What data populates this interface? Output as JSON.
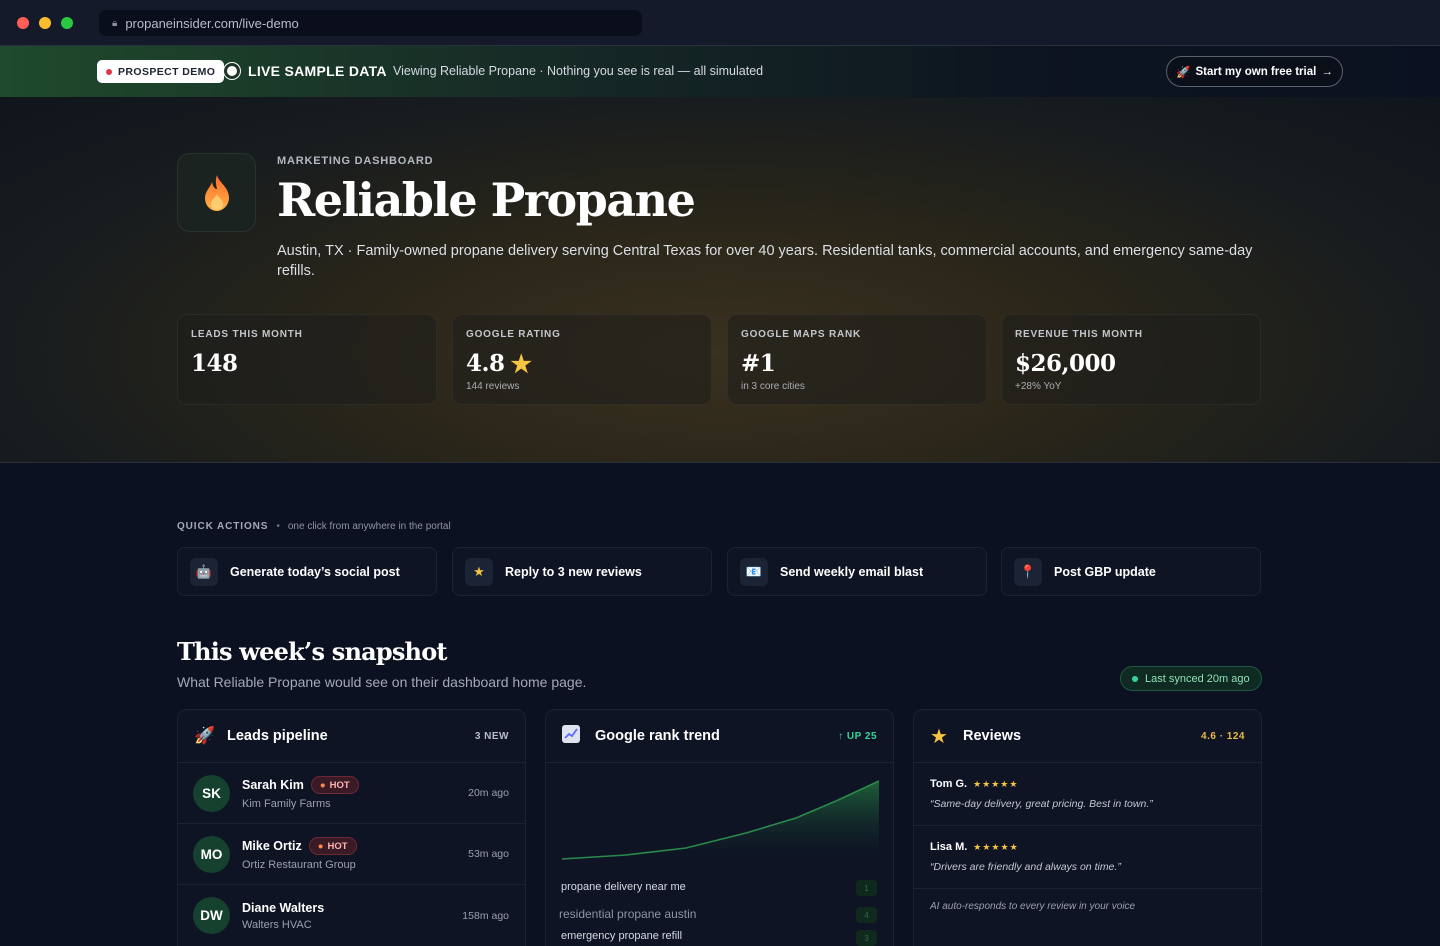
{
  "browser": {
    "url": "propaneinsider.com/live-demo"
  },
  "banner": {
    "demo_pill": "PROSPECT DEMO",
    "live_label": "LIVE SAMPLE DATA",
    "note": "Viewing Reliable Propane · Nothing you see is real — all simulated",
    "trial_button": "Start my own free trial",
    "trial_arrow": "→"
  },
  "hero": {
    "eyebrow": "MARKETING DASHBOARD",
    "title": "Reliable Propane",
    "description": "Austin, TX · Family-owned propane delivery serving Central Texas for over 40 years. Residential tanks, commercial accounts, and emergency same-day refills."
  },
  "stats": [
    {
      "label": "LEADS THIS MONTH",
      "value": "148",
      "sub": ""
    },
    {
      "label": "GOOGLE RATING",
      "value": "4.8",
      "sub": "144 reviews"
    },
    {
      "label": "GOOGLE MAPS RANK",
      "value": "#1",
      "sub": "in 3 core cities"
    },
    {
      "label": "REVENUE THIS MONTH",
      "value": "$26,000",
      "sub": "+28% YoY"
    }
  ],
  "quick_actions": {
    "title": "QUICK ACTIONS",
    "note": "one click from anywhere in the portal",
    "items": [
      {
        "label": "Generate today’s social post",
        "icon": "robot-icon"
      },
      {
        "label": "Reply to 3 new reviews",
        "icon": "star-icon"
      },
      {
        "label": "Send weekly email blast",
        "icon": "email-icon"
      },
      {
        "label": "Post GBP update",
        "icon": "pin-icon"
      }
    ]
  },
  "snapshot": {
    "title": "This week’s snapshot",
    "subtitle": "What Reliable Propane would see on their dashboard home page.",
    "sync": "Last synced 20m ago"
  },
  "leads_card": {
    "title": "Leads pipeline",
    "badge": "3 NEW",
    "hot_label": "HOT",
    "leads": [
      {
        "initials": "SK",
        "name": "Sarah Kim",
        "company": "Kim Family Farms",
        "time": "20m ago",
        "hot": true
      },
      {
        "initials": "MO",
        "name": "Mike Ortiz",
        "company": "Ortiz Restaurant Group",
        "time": "53m ago",
        "hot": true
      },
      {
        "initials": "DW",
        "name": "Diane Walters",
        "company": "Walters HVAC",
        "time": "158m ago",
        "hot": false
      }
    ]
  },
  "rank_card": {
    "title": "Google rank trend",
    "badge": "↑ UP 25",
    "keywords": [
      {
        "keyword": "propane delivery near me",
        "rank": "1"
      },
      {
        "keyword": "residential propane austin",
        "rank": "4"
      },
      {
        "keyword": "emergency propane refill",
        "rank": "3"
      }
    ]
  },
  "reviews_card": {
    "title": "Reviews",
    "badge": "4.6 · 124",
    "reviews": [
      {
        "name": "Tom G.",
        "stars": "★★★★★",
        "quote": "“Same-day delivery, great pricing. Best in town.”"
      },
      {
        "name": "Lisa M.",
        "stars": "★★★★★",
        "quote": "“Drivers are friendly and always on time.”"
      }
    ],
    "ai_note": "AI auto-responds to every review in your voice"
  },
  "colors": {
    "accent_green": "#34d399",
    "hot_red": "#e0364a",
    "star_gold": "#f6c343",
    "badge_gold": "#e9b949"
  }
}
